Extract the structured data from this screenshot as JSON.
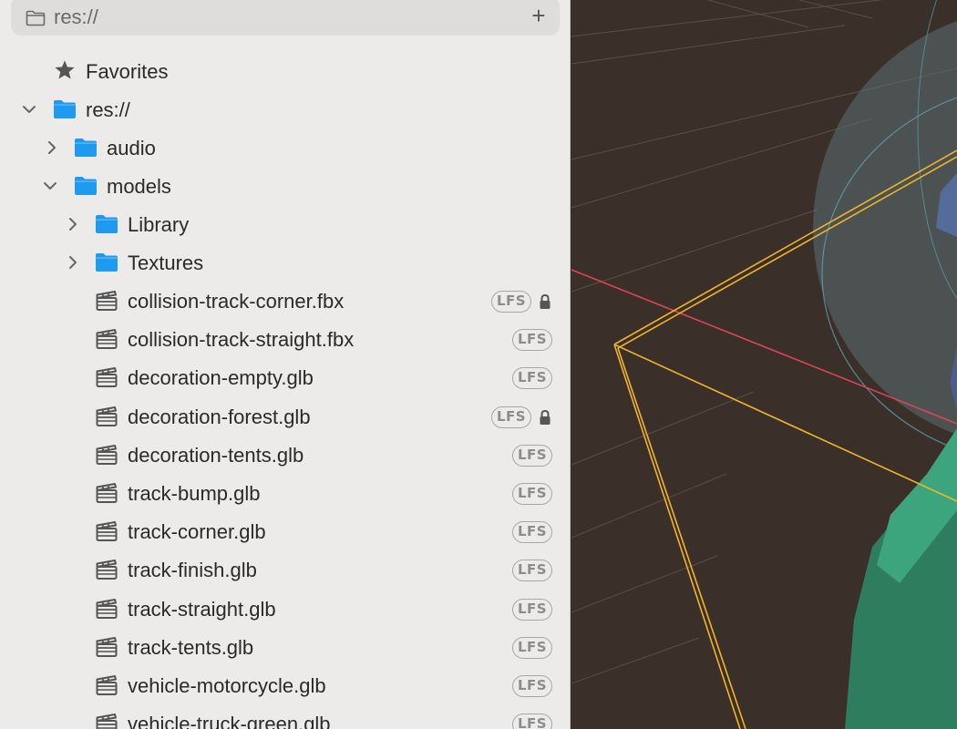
{
  "pathbar": {
    "path": "res://",
    "add_label": "+"
  },
  "tree": {
    "favorites": "Favorites",
    "root": "res://",
    "folders": {
      "audio": "audio",
      "models": "models",
      "library": "Library",
      "textures": "Textures"
    },
    "files": [
      {
        "name": "collision-track-corner.fbx",
        "badge": "LFS",
        "locked": true
      },
      {
        "name": "collision-track-straight.fbx",
        "badge": "LFS",
        "locked": false
      },
      {
        "name": "decoration-empty.glb",
        "badge": "LFS",
        "locked": false
      },
      {
        "name": "decoration-forest.glb",
        "badge": "LFS",
        "locked": true
      },
      {
        "name": "decoration-tents.glb",
        "badge": "LFS",
        "locked": false
      },
      {
        "name": "track-bump.glb",
        "badge": "LFS",
        "locked": false
      },
      {
        "name": "track-corner.glb",
        "badge": "LFS",
        "locked": false
      },
      {
        "name": "track-finish.glb",
        "badge": "LFS",
        "locked": false
      },
      {
        "name": "track-straight.glb",
        "badge": "LFS",
        "locked": false
      },
      {
        "name": "track-tents.glb",
        "badge": "LFS",
        "locked": false
      },
      {
        "name": "vehicle-motorcycle.glb",
        "badge": "LFS",
        "locked": false
      },
      {
        "name": "vehicle-truck-green.glb",
        "badge": "LFS",
        "locked": false
      }
    ]
  },
  "colors": {
    "folder": "#1e9bf0",
    "viewport_bg": "#3b3029",
    "selection_box": "#f0b429",
    "x_axis": "#e0445a",
    "model_green": "#3da57d"
  }
}
